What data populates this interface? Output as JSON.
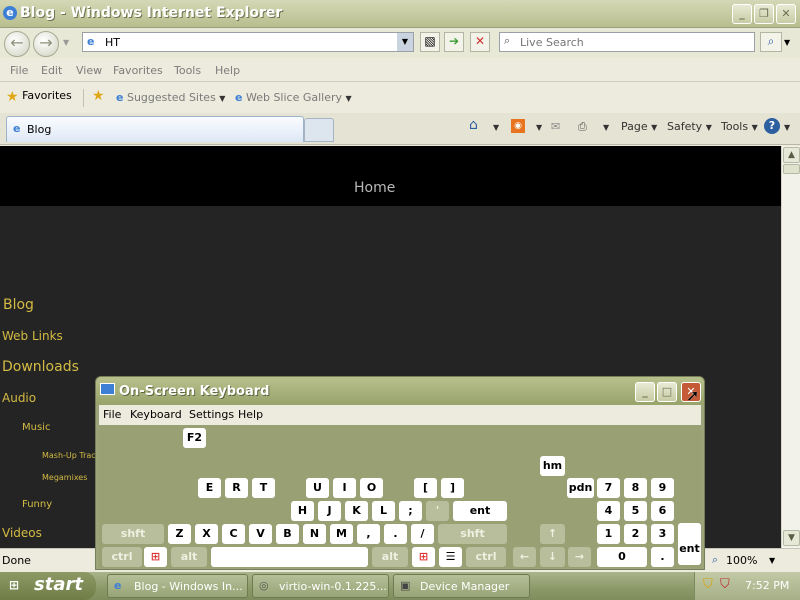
{
  "browser": {
    "title": "Blog - Windows Internet Explorer",
    "address": "HT",
    "search_placeholder": "Live Search",
    "menu": [
      "File",
      "Edit",
      "View",
      "Favorites",
      "Tools",
      "Help"
    ],
    "favorites_label": "Favorites",
    "suggested_sites": "Suggested Sites",
    "web_slice_gallery": "Web Slice Gallery",
    "tab_title": "Blog",
    "commands": {
      "page": "Page",
      "safety": "Safety",
      "tools": "Tools"
    }
  },
  "page": {
    "home": "Home",
    "sidebar": {
      "blog": "Blog",
      "web_links": "Web Links",
      "downloads": "Downloads",
      "audio": "Audio",
      "music": "Music",
      "mashup": "Mash-Up Track",
      "megamixes": "Megamixes",
      "funny": "Funny",
      "videos": "Videos"
    },
    "accent_color": "#d4bb43"
  },
  "status": {
    "text": "Done",
    "zoom": "100%"
  },
  "taskbar": {
    "start": "start",
    "tasks": [
      "Blog - Windows In...",
      "virtio-win-0.1.225...",
      "Device Manager"
    ],
    "clock": "7:52 PM"
  },
  "osk": {
    "title": "On-Screen Keyboard",
    "menu": [
      "File",
      "Keyboard",
      "Settings",
      "Help"
    ],
    "keys": {
      "f2": "F2",
      "e": "E",
      "r": "R",
      "t": "T",
      "u": "U",
      "i": "I",
      "o": "O",
      "lbracket": "[",
      "rbracket": "]",
      "h": "H",
      "j": "J",
      "k": "K",
      "l": "L",
      "semicolon": ";",
      "quote": "'",
      "enter": "ent",
      "shift": "shft",
      "z": "Z",
      "x": "X",
      "c": "C",
      "v": "V",
      "b": "B",
      "n": "N",
      "m": "M",
      "comma": ",",
      "period": ".",
      "slash": "/",
      "ctrl": "ctrl",
      "alt": "alt",
      "hm": "hm",
      "pdn": "pdn",
      "n7": "7",
      "n8": "8",
      "n9": "9",
      "n4": "4",
      "n5": "5",
      "n6": "6",
      "n1": "1",
      "n2": "2",
      "n3": "3",
      "n0": "0",
      "ndot": ".",
      "nent": "ent"
    }
  }
}
